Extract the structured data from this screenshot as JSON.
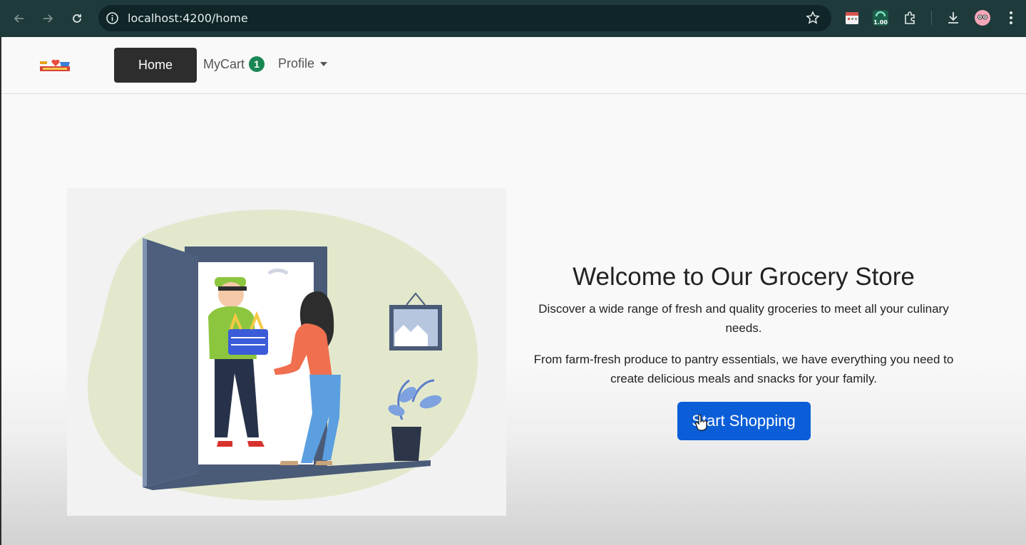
{
  "browser": {
    "url": "localhost:4200/home",
    "extension_badge": "1.00"
  },
  "navbar": {
    "home_label": "Home",
    "cart_label": "MyCart",
    "cart_count": "1",
    "profile_label": "Profile"
  },
  "hero": {
    "title": "Welcome to Our Grocery Store",
    "paragraph1": "Discover a wide range of fresh and quality groceries to meet all your culinary needs.",
    "paragraph2": "From farm-fresh produce to pantry essentials, we have everything you need to create delicious meals and snacks for your family.",
    "cta_label": "Start Shopping"
  },
  "colors": {
    "accent": "#0b5ed7",
    "badge": "#198754",
    "home_button": "#2d2d2d",
    "chrome": "#1f3a3a"
  }
}
